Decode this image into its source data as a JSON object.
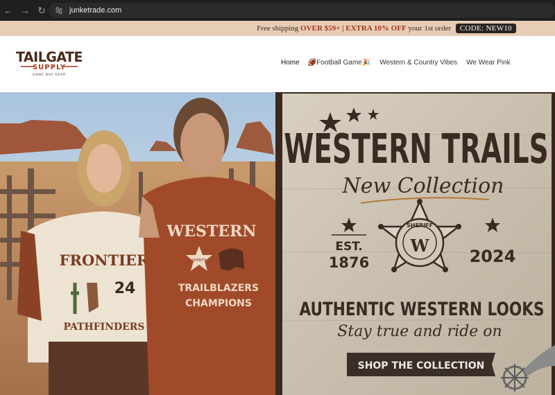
{
  "browser": {
    "url": "junketrade.com",
    "back_icon": "←",
    "forward_icon": "→",
    "reload_icon": "↻"
  },
  "announcement": {
    "prefix": "Free shipping ",
    "highlight_1": "OVER $59+ | EXTRA 10% OFF",
    "middle": " your 1st order ",
    "code": "CODE: NEW10"
  },
  "logo": {
    "line1": "TAILGATE",
    "line2": "SUPPLY",
    "tagline": "GAME DAY GEAR"
  },
  "nav": {
    "items": [
      {
        "label": "Home"
      },
      {
        "label": "🏈Football Game🎉"
      },
      {
        "label": "Western & Country Vibes"
      },
      {
        "label": "We Wear Pink"
      }
    ]
  },
  "hero": {
    "sign_title": "WESTERN TRAILS",
    "sign_subtitle": "New Collection",
    "est_label": "EST.",
    "est_year": "1876",
    "year_right": "2024",
    "badge_word": "SHERIFF",
    "badge_letter": "W",
    "headline": "AUTHENTIC WESTERN LOOKS",
    "tagline": "Stay true and ride on",
    "cta": "SHOP THE COLLECTION",
    "woman_shirt": {
      "line1": "FRONTIER",
      "number": "24",
      "line2": "PATHFINDERS"
    },
    "man_shirt": {
      "line1": "WESTERN",
      "badge": "SHERIFF",
      "line2": "TRAILBLAZERS",
      "line3": "CHAMPIONS"
    }
  },
  "colors": {
    "chrome_bg": "#1f1f1f",
    "announce_bg": "#e7cdb5",
    "accent_red": "#a6371e",
    "logo_brown": "#4a2a1c",
    "sign_wood": "#cfc5b6",
    "shirt_rust": "#a14a2a"
  }
}
